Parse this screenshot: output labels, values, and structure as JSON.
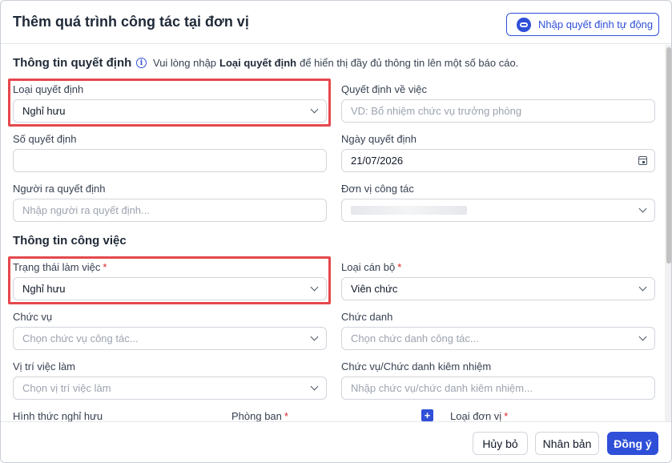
{
  "dialog": {
    "title": "Thêm quá trình công tác tại đơn vị",
    "ai_button_label": "Nhập quyết định tự động"
  },
  "decision_section": {
    "title": "Thông tin quyết định",
    "info_prefix": "Vui lòng nhập",
    "info_bold": "Loại quyết định",
    "info_suffix": "để hiển thị đầy đủ thông tin lên một số báo cáo.",
    "decision_type": {
      "label": "Loại quyết định",
      "value": "Nghỉ hưu"
    },
    "decision_about": {
      "label": "Quyết định về việc",
      "placeholder": "VD: Bổ nhiệm chức vụ trưởng phòng"
    },
    "decision_number": {
      "label": "Số quyết định",
      "value": ""
    },
    "decision_date": {
      "label": "Ngày quyết định",
      "value": "21/07/2026"
    },
    "issuer": {
      "label": "Người ra quyết định",
      "placeholder": "Nhập người ra quyết định..."
    },
    "work_unit": {
      "label": "Đơn vị công tác"
    }
  },
  "job_section": {
    "title": "Thông tin công việc",
    "work_status": {
      "label": "Trạng thái làm việc",
      "required": "*",
      "value": "Nghỉ hưu"
    },
    "staff_type": {
      "label": "Loại cán bộ",
      "required": "*",
      "value": "Viên chức"
    },
    "position": {
      "label": "Chức vụ",
      "placeholder": "Chọn chức vụ công tác..."
    },
    "title_field": {
      "label": "Chức danh",
      "placeholder": "Chọn chức danh công tác..."
    },
    "job_placement": {
      "label": "Vị trí việc làm",
      "placeholder": "Chọn vị trí việc làm"
    },
    "concurrent": {
      "label": "Chức vụ/Chức danh kiêm nhiệm",
      "placeholder": "Nhập chức vụ/chức danh kiêm nhiệm..."
    },
    "retirement_form": {
      "label": "Hình thức nghỉ hưu"
    },
    "department": {
      "label": "Phòng ban",
      "required": "*"
    },
    "plus_symbol": "+",
    "unit_type": {
      "label": "Loại đơn vị",
      "required": "*"
    }
  },
  "footer": {
    "cancel_label": "Hủy bỏ",
    "duplicate_label": "Nhân bản",
    "confirm_label": "Đồng ý"
  },
  "colors": {
    "accent": "#2f4fd8",
    "highlight": "#e5484d",
    "required": "#dc2626"
  }
}
